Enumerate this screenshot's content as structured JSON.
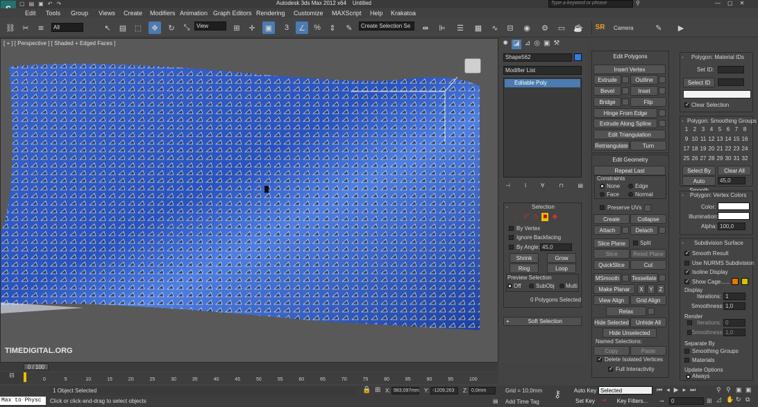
{
  "title": {
    "app": "Autodesk 3ds Max 2012 x64",
    "doc": "Untitled",
    "search_placeholder": "Type a keyword or phrase"
  },
  "menu": [
    "Edit",
    "Tools",
    "Group",
    "Views",
    "Create",
    "Modifiers",
    "Animation",
    "Graph Editors",
    "Rendering",
    "Customize",
    "MAXScript",
    "Help",
    "Krakatoa"
  ],
  "toolbar": {
    "selection_filter": "All",
    "ref_coord": "View",
    "named_selection": "Create Selection Se",
    "sr_label": "SR",
    "camera_label": "Camera"
  },
  "viewport": {
    "label": "[ + ] [ Perspective ] [ Shaded + Edged Faces ]",
    "gizmo_label": "",
    "watermark": "TIMEDIGITAL.ORG"
  },
  "command_panel": {
    "object_name": "Shape562",
    "object_color": "#2f7de8",
    "modifier_list": "Modifier List",
    "stack_item": "Editable Poly",
    "selection": {
      "title": "Selection",
      "by_vertex": "By Vertex",
      "ignore_backfacing": "Ignore Backfacing",
      "by_angle": "By Angle:",
      "by_angle_value": "45,0",
      "shrink": "Shrink",
      "grow": "Grow",
      "ring": "Ring",
      "loop": "Loop",
      "preview_title": "Preview Selection",
      "off": "Off",
      "subobj": "SubObj",
      "multi": "Multi",
      "status": "0 Polygons Selected"
    },
    "soft_selection": "Soft Selection"
  },
  "edit_polygons": {
    "title": "Edit Polygons",
    "insert_vertex": "Insert Vertex",
    "extrude": "Extrude",
    "outline": "Outline",
    "bevel": "Bevel",
    "inset": "Inset",
    "bridge": "Bridge",
    "flip": "Flip",
    "hinge": "Hinge From Edge",
    "extrude_spline": "Extrude Along Spline",
    "edit_tri": "Edit Triangulation",
    "retri": "Retriangulate",
    "turn": "Turn"
  },
  "edit_geometry": {
    "title": "Edit Geometry",
    "repeat_last": "Repeat Last",
    "constraints": "Constraints",
    "none": "None",
    "edge": "Edge",
    "face": "Face",
    "normal": "Normal",
    "preserve_uvs": "Preserve UVs",
    "create": "Create",
    "collapse": "Collapse",
    "attach": "Attach",
    "detach": "Detach",
    "slice_plane": "Slice Plane",
    "split": "Split",
    "slice": "Slice",
    "reset_plane": "Reset Plane",
    "quickslice": "QuickSlice",
    "cut": "Cut",
    "msmooth": "MSmooth",
    "tessellate": "Tessellate",
    "make_planar": "Make Planar",
    "x": "X",
    "y": "Y",
    "z": "Z",
    "view_align": "View Align",
    "grid_align": "Grid Align",
    "relax": "Relax",
    "hide_selected": "Hide Selected",
    "unhide_all": "Unhide All",
    "hide_unselected": "Hide Unselected",
    "named_selections": "Named Selections:",
    "copy": "Copy",
    "paste": "Paste",
    "delete_isolated": "Delete Isolated Vertices",
    "full_interactivity": "Full Interactivity"
  },
  "material_ids": {
    "title": "Polygon: Material IDs",
    "set_id": "Set ID:",
    "select_id": "Select ID",
    "clear_selection": "Clear Selection"
  },
  "smoothing_groups": {
    "title": "Polygon: Smoothing Groups",
    "numbers": [
      "1",
      "2",
      "3",
      "4",
      "5",
      "6",
      "7",
      "8",
      "9",
      "10",
      "11",
      "12",
      "13",
      "14",
      "15",
      "16",
      "17",
      "18",
      "19",
      "20",
      "21",
      "22",
      "23",
      "24",
      "25",
      "26",
      "27",
      "28",
      "29",
      "30",
      "31",
      "32"
    ],
    "select_by_sg": "Select By SG",
    "clear_all": "Clear All",
    "auto_smooth": "Auto Smooth",
    "auto_smooth_value": "45,0"
  },
  "vertex_colors": {
    "title": "Polygon: Vertex Colors",
    "color": "Color:",
    "illumination": "Illumination:",
    "alpha": "Alpha:",
    "alpha_value": "100,0"
  },
  "subdivision": {
    "title": "Subdivision Surface",
    "smooth_result": "Smooth Result",
    "use_nurms": "Use NURMS Subdivision",
    "isoline": "Isoline Display",
    "show_cage": "Show Cage......",
    "display": "Display",
    "iterations": "Iterations:",
    "iterations_value": "1",
    "smoothness": "Smoothness:",
    "smoothness_value": "1,0",
    "render": "Render",
    "r_iterations_value": "0",
    "r_smoothness_value": "1,0",
    "separate_by": "Separate By",
    "sep_sg": "Smoothing Groups",
    "sep_mat": "Materials",
    "update_options": "Update Options",
    "always": "Always",
    "cage_color1": "#e07b00",
    "cage_color2": "#d6c000"
  },
  "timeline": {
    "frame": "0 / 100",
    "ticks": [
      "0",
      "5",
      "10",
      "15",
      "20",
      "25",
      "30",
      "35",
      "40",
      "45",
      "50",
      "55",
      "60",
      "65",
      "70",
      "75",
      "80",
      "85",
      "90",
      "95",
      "100"
    ]
  },
  "status": {
    "script_label": "Max to Physc",
    "objects": "1 Object Selected",
    "prompt": "Click or click-and-drag to select objects",
    "x_label": "X:",
    "x_value": "983,097mm",
    "y_label": "Y:",
    "y_value": "-1209,263",
    "z_label": "Z:",
    "z_value": "0,0mm",
    "grid": "Grid = 10,0mm",
    "add_time_tag": "Add Time Tag",
    "auto_key": "Auto Key",
    "selected": "Selected",
    "set_key": "Set Key",
    "key_filters": "Key Filters...",
    "frame_value": "0"
  }
}
